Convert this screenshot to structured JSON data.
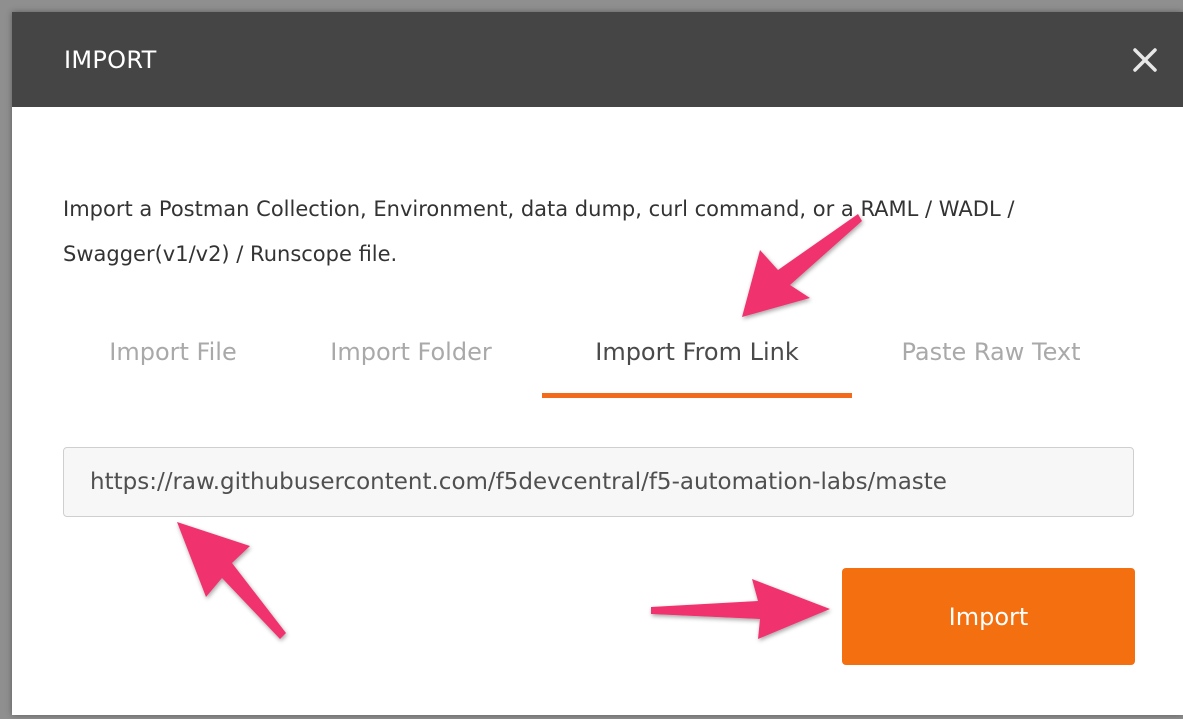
{
  "dialog": {
    "title": "IMPORT",
    "close_icon": "close-icon",
    "description": "Import a Postman Collection, Environment, data dump, curl command, or a RAML / WADL / Swagger(v1/v2) / Runscope file."
  },
  "tabs": [
    {
      "label": "Import File",
      "active": false
    },
    {
      "label": "Import Folder",
      "active": false
    },
    {
      "label": "Import From Link",
      "active": true
    },
    {
      "label": "Paste Raw Text",
      "active": false
    }
  ],
  "link_input": {
    "value": "https://raw.githubusercontent.com/f5devcentral/f5-automation-labs/maste"
  },
  "import_button": {
    "label": "Import"
  },
  "colors": {
    "header_bg": "#454545",
    "accent": "#f36f0f",
    "annotation_arrow": "#f0336e"
  }
}
